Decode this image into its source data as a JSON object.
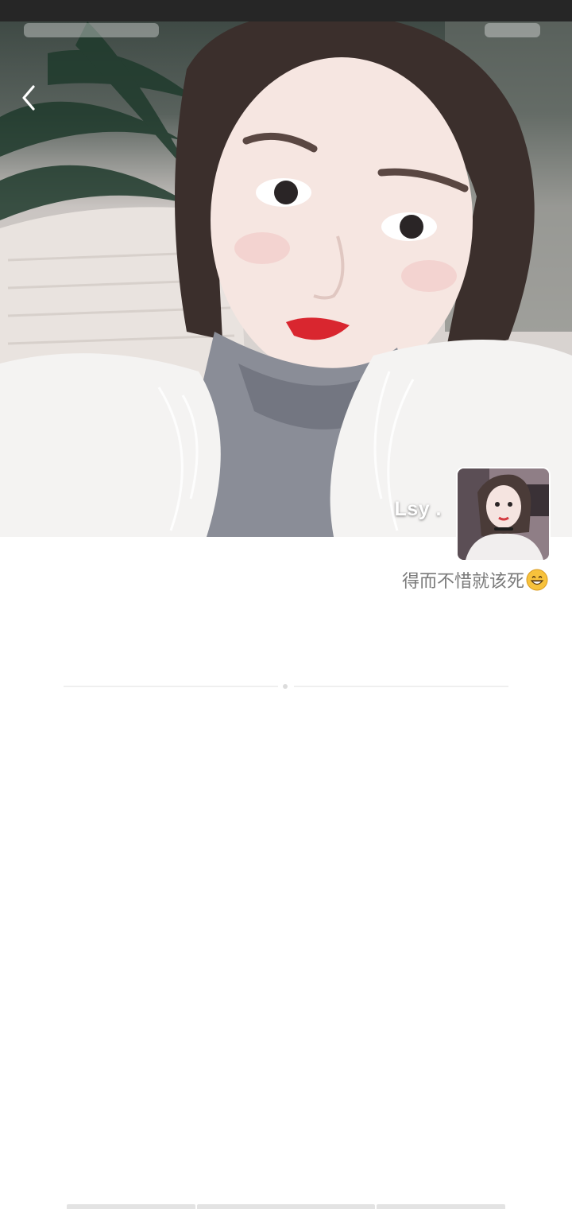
{
  "profile": {
    "nickname": "Lsy .",
    "signature": "得而不惜就该死"
  },
  "icons": {
    "back": "chevron-left-icon",
    "signature_emoji": "grinning-face-icon"
  },
  "colors": {
    "status_bar": "#262626",
    "signature_text": "#7a7a7a",
    "divider": "#efefef"
  }
}
